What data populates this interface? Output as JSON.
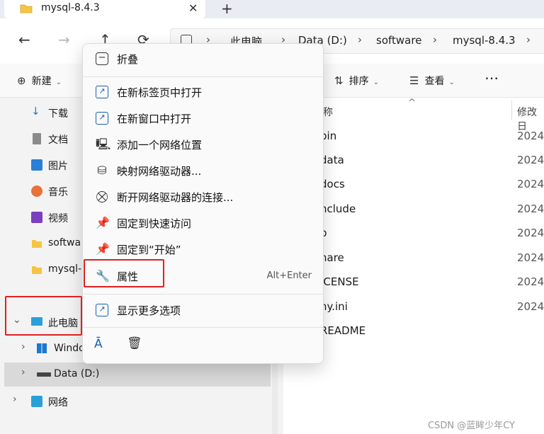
{
  "tab": {
    "title": "mysql-8.4.3",
    "close_glyph": "✕",
    "new_glyph": "+"
  },
  "nav": {
    "back": "←",
    "forward": "→",
    "up": "↑",
    "refresh": "⟳"
  },
  "address": {
    "crumbs": [
      "此电脑",
      "Data (D:)",
      "software",
      "mysql-8.4.3"
    ],
    "separator": "›"
  },
  "commands": {
    "new_label": "新建",
    "sort_label": "排序",
    "view_label": "查看",
    "more_glyph": "⋯"
  },
  "sidebar": {
    "items": [
      {
        "label": "下载",
        "icon": "download-icon"
      },
      {
        "label": "文档",
        "icon": "document-icon"
      },
      {
        "label": "图片",
        "icon": "pictures-icon"
      },
      {
        "label": "音乐",
        "icon": "music-icon"
      },
      {
        "label": "视频",
        "icon": "video-icon"
      },
      {
        "label": "softwa",
        "icon": "folder-icon"
      },
      {
        "label": "mysql-",
        "icon": "folder-icon"
      },
      {
        "label": "此电脑",
        "icon": "computer-icon"
      },
      {
        "label": "Windo",
        "icon": "windows-icon"
      },
      {
        "label": "Data (D:)",
        "icon": "drive-icon"
      },
      {
        "label": "网络",
        "icon": "network-icon"
      }
    ]
  },
  "filelist": {
    "header_name": "称",
    "header_date": "修改日",
    "rows": [
      {
        "name": "bin",
        "date": "2024/"
      },
      {
        "name": "data",
        "date": "2024/"
      },
      {
        "name": "docs",
        "date": "2024/"
      },
      {
        "name": "nclude",
        "date": "2024/"
      },
      {
        "name": "b",
        "date": "2024/"
      },
      {
        "name": "hare",
        "date": "2024/"
      },
      {
        "name": "ICENSE",
        "date": "2024/"
      },
      {
        "name": "ny.ini",
        "date": "2024/"
      },
      {
        "name": "README",
        "date": "2024/"
      }
    ]
  },
  "context_menu": {
    "collapse": "折叠",
    "open_new_tab": "在新标签页中打开",
    "open_new_window": "在新窗口中打开",
    "add_network_location": "添加一个网络位置",
    "map_network_drive": "映射网络驱动器...",
    "disconnect_network_drive": "断开网络驱动器的连接...",
    "pin_quick_access": "固定到快速访问",
    "pin_start": "固定到“开始”",
    "properties": "属性",
    "properties_shortcut": "Alt+Enter",
    "show_more_options": "显示更多选项"
  },
  "colors": {
    "highlight_red": "#e02020",
    "icon_blue": "#1b5fb0"
  },
  "watermark": "CSDN @蓝眸少年CY"
}
